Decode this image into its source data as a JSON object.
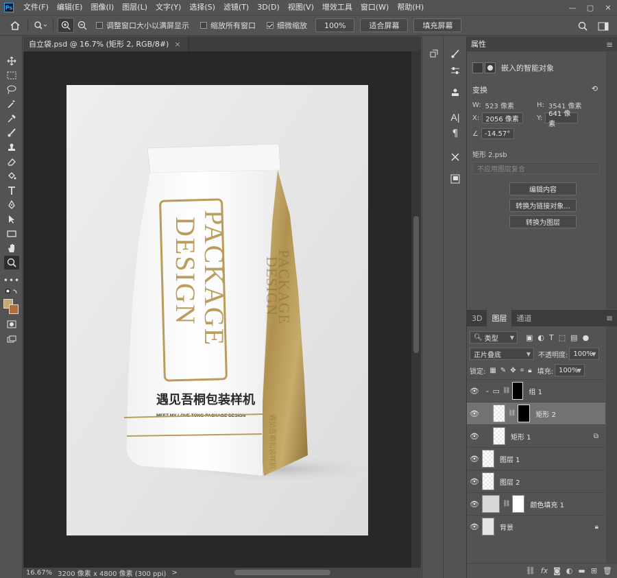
{
  "app": {
    "logo": "Ps",
    "menu": [
      "文件(F)",
      "编辑(E)",
      "图像(I)",
      "图层(L)",
      "文字(Y)",
      "选择(S)",
      "滤镜(T)",
      "3D(D)",
      "视图(V)",
      "增效工具",
      "窗口(W)",
      "帮助(H)"
    ],
    "window_controls": [
      "—",
      "▢",
      "✕"
    ]
  },
  "options": {
    "resize_windows_label": "调整窗口大小以满屏显示",
    "zoom_all_label": "缩放所有窗口",
    "scrubby_zoom_label": "细微缩放",
    "zoom_value": "100%",
    "fit_screen_label": "适合屏幕",
    "fill_screen_label": "填充屏幕",
    "resize_windows_checked": false,
    "zoom_all_checked": false,
    "scrubby_zoom_checked": true
  },
  "document": {
    "tab_title": "自立袋.psd @ 16.7% (矩形 2, RGB/8#)",
    "tab_close": "×",
    "status_zoom": "16.67%",
    "status_info": "3200 像素 x 4800 像素 (300 ppi)",
    "status_arrow": ">"
  },
  "artwork": {
    "bag_main_text": "PACKAGE DESIGN",
    "bag_side_text": "PACKAGE DESIGN",
    "bag_cn_title": "遇见吾桐包装样机",
    "bag_en_subtitle": "MEET MY LOVE TONG PACKAGE DESIGN",
    "bag_side_cn": "遇见吾桐包装样机",
    "gold_color": "#b69a5a"
  },
  "properties": {
    "title": "属性",
    "object_type": "嵌入的智能对象",
    "transform_label": "变换",
    "w_label": "W:",
    "w_value": "523 像素",
    "h_label": "H:",
    "h_value": "3541 像素",
    "x_label": "X:",
    "x_value": "2056 像素",
    "y_label": "Y:",
    "y_value": "641 像素",
    "angle_value": "-14.57°",
    "file_name": "矩形 2.psb",
    "comp_select": "不应用图层复合",
    "edit_contents_btn": "编辑内容",
    "convert_linked_btn": "转换为链接对象...",
    "convert_layers_btn": "转换为图层"
  },
  "layers_panel": {
    "tabs": [
      "3D",
      "图层",
      "通道"
    ],
    "active_tab": "图层",
    "filter_label": "类型",
    "blend_mode": "正片叠底",
    "opacity_label": "不透明度:",
    "opacity_value": "100%",
    "lock_label": "锁定:",
    "fill_label": "填充:",
    "fill_value": "100%",
    "layers": [
      {
        "name": "组 1",
        "selected": false
      },
      {
        "name": "矩形 2",
        "selected": true
      },
      {
        "name": "矩形 1",
        "selected": false
      },
      {
        "name": "图层 1",
        "selected": false
      },
      {
        "name": "图层 2",
        "selected": false
      },
      {
        "name": "颜色填充 1",
        "selected": false
      },
      {
        "name": "背景",
        "selected": false
      }
    ],
    "bottom_icons": [
      "link-icon",
      "fx-icon",
      "mask-icon",
      "adjustment-icon",
      "folder-icon",
      "new-layer-icon",
      "trash-icon"
    ],
    "fx_label": "fx"
  }
}
